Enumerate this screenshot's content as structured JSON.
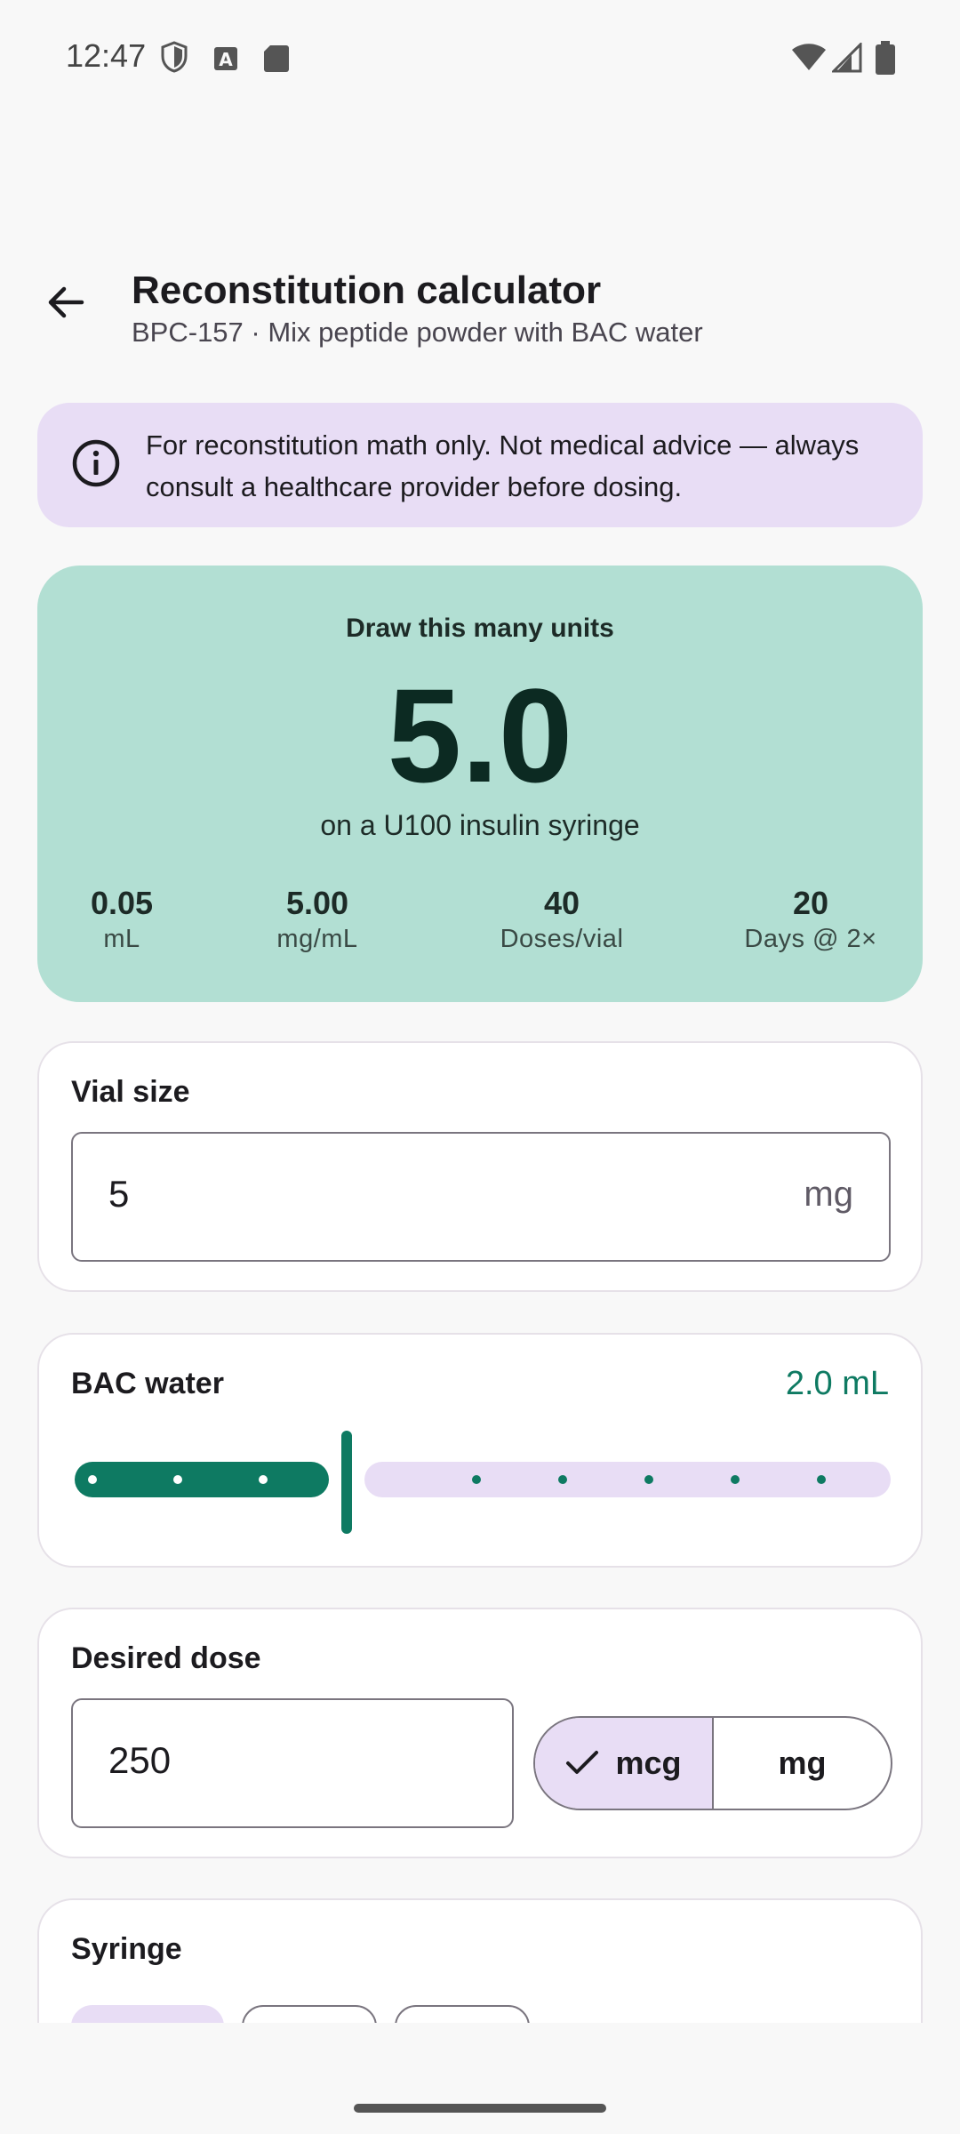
{
  "status_bar": {
    "time": "12:47",
    "icons": [
      "shield-icon",
      "font-icon",
      "sd-card-icon",
      "wifi-icon",
      "signal-icon",
      "battery-icon"
    ]
  },
  "header": {
    "back_icon": "arrow-left-icon",
    "title": "Reconstitution calculator",
    "subtitle": "BPC-157 · Mix peptide powder with BAC water"
  },
  "disclaimer": {
    "icon": "info-icon",
    "text": "For reconstitution math only. Not medical advice — always consult a healthcare provider before dosing."
  },
  "result": {
    "label": "Draw this many units",
    "value": "5.0",
    "caption": "on a U100 insulin syringe",
    "stats": [
      {
        "value": "0.05",
        "label": "mL"
      },
      {
        "value": "5.00",
        "label": "mg/mL"
      },
      {
        "value": "40",
        "label": "Doses/vial"
      },
      {
        "value": "20",
        "label": "Days @ 2×"
      }
    ]
  },
  "vial_size": {
    "title": "Vial size",
    "value": "5",
    "unit": "mg"
  },
  "bac_water": {
    "title": "BAC water",
    "value_text": "2.0 mL",
    "slider_fraction": 0.3
  },
  "desired_dose": {
    "title": "Desired dose",
    "value": "250",
    "units": [
      {
        "label": "mcg",
        "selected": true
      },
      {
        "label": "mg",
        "selected": false
      }
    ]
  },
  "syringe": {
    "title": "Syringe"
  },
  "colors": {
    "accent": "#0e7a62",
    "result_bg": "#b2dfd3",
    "tonal": "#e8ddf5"
  }
}
